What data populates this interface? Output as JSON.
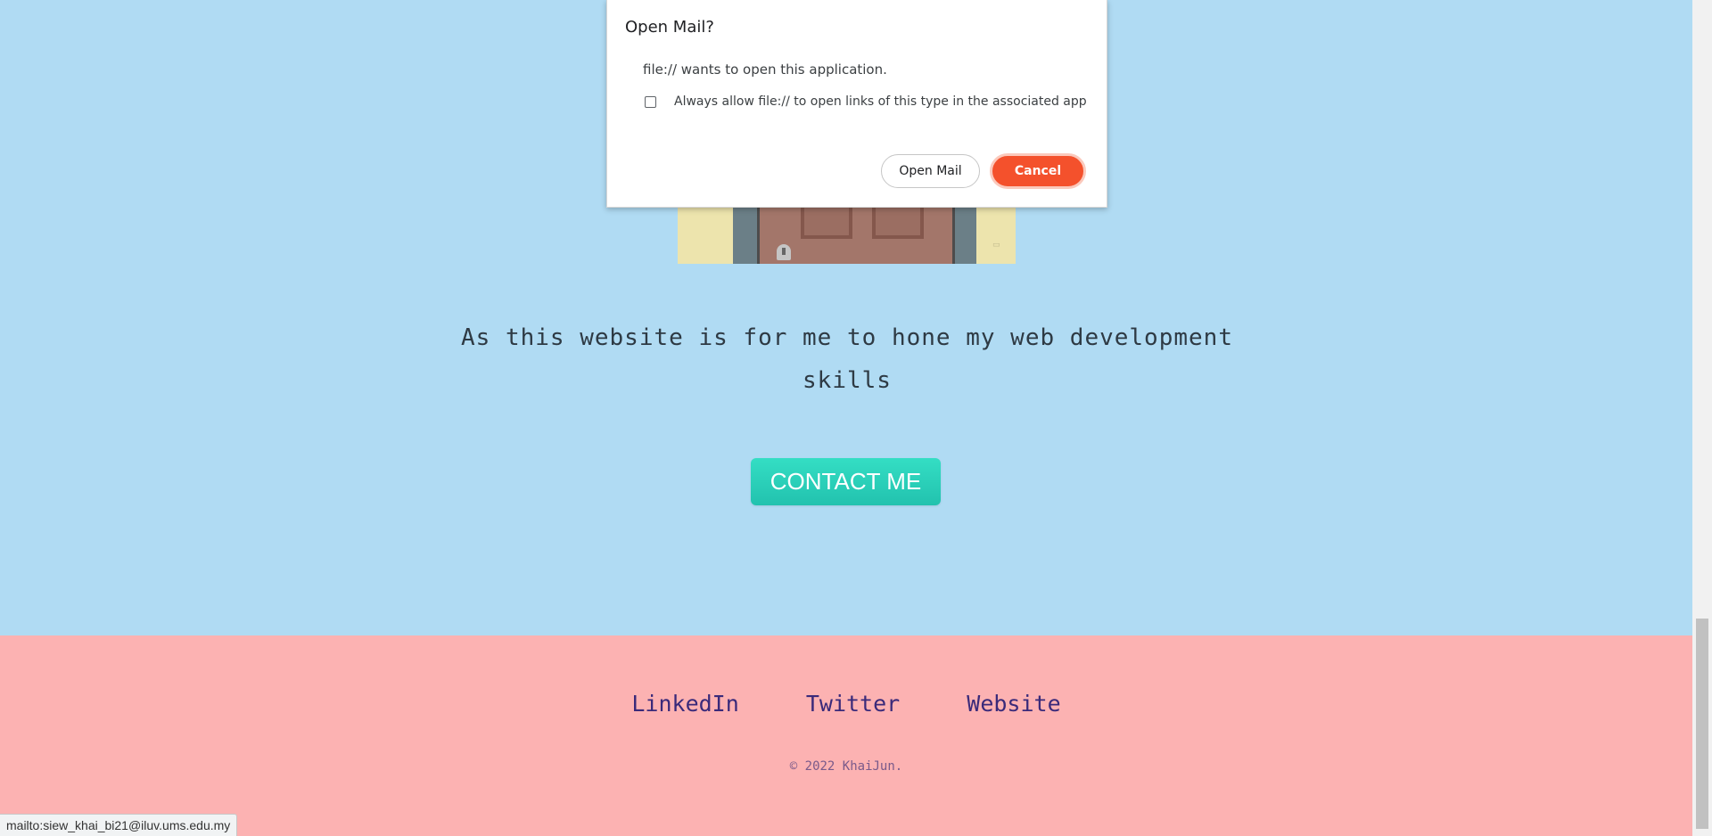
{
  "hero": {
    "illustration_alt": "door-illustration",
    "text": "As this website is for me to hone my web development skills",
    "contact_button": "CONTACT ME"
  },
  "footer": {
    "links": [
      "LinkedIn",
      "Twitter",
      "Website"
    ],
    "copyright": "© 2022 KhaiJun."
  },
  "dialog": {
    "title": "Open Mail?",
    "message": "file:// wants to open this application.",
    "checkbox_label": "Always allow file:// to open links of this type in the associated app",
    "checkbox_checked": false,
    "open_button": "Open Mail",
    "cancel_button": "Cancel"
  },
  "status_bar": {
    "url": "mailto:siew_khai_bi21@iluv.ums.edu.my"
  },
  "colors": {
    "hero_bg": "#b0dbf3",
    "footer_bg": "#fcb2b2",
    "contact_button": "#2ad0b8",
    "cancel_button": "#f4512c",
    "footer_link": "#3a2a7a"
  }
}
